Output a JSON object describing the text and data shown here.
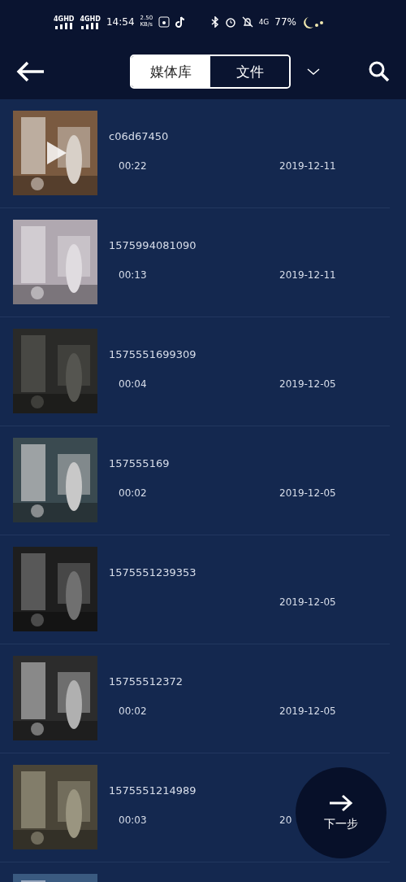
{
  "status_bar": {
    "signal_1": "4GHD",
    "signal_2": "4GHD",
    "time": "14:54",
    "speed_value": "2.50",
    "speed_unit": "KB/s",
    "network": "4G",
    "battery": "77%"
  },
  "header": {
    "tabs": [
      {
        "label": "媒体库",
        "selected": true
      },
      {
        "label": "文件",
        "selected": false
      }
    ]
  },
  "items": [
    {
      "name": "c06d67450",
      "duration": "00:22",
      "date": "2019-12-11",
      "play_overlay": true
    },
    {
      "name": "1575994081090",
      "duration": "00:13",
      "date": "2019-12-11",
      "play_overlay": false
    },
    {
      "name": "1575551699309",
      "duration": "00:04",
      "date": "2019-12-05",
      "play_overlay": false
    },
    {
      "name": "157555169",
      "duration": "00:02",
      "date": "2019-12-05",
      "play_overlay": false
    },
    {
      "name": "1575551239353",
      "date": "2019-12-05",
      "play_overlay": false
    },
    {
      "name": "15755512372",
      "duration": "00:02",
      "date": "2019-12-05",
      "play_overlay": false
    },
    {
      "name": "1575551214989",
      "duration": "00:03",
      "date": "20",
      "play_overlay": false
    },
    {
      "play_overlay": false
    }
  ],
  "next_button": {
    "label": "下一步"
  }
}
